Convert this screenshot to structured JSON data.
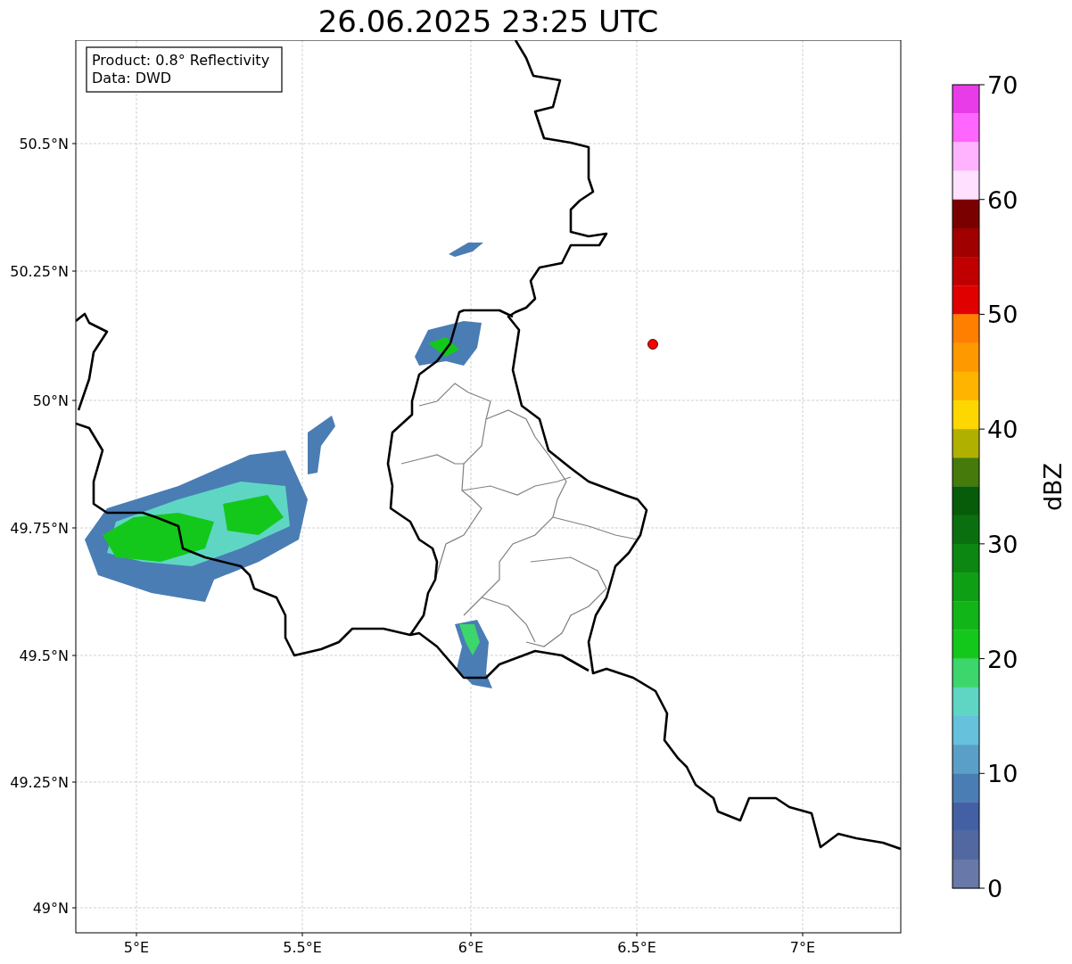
{
  "title": "26.06.2025 23:25 UTC",
  "legend": [
    "Product: 0.8° Reflectivity",
    "Data: DWD"
  ],
  "y_ticks": [
    "50.5°N",
    "50.25°N",
    "50°N",
    "49.75°N",
    "49.5°N",
    "49.25°N",
    "49°N"
  ],
  "x_ticks": [
    "5°E",
    "5.5°E",
    "6°E",
    "6.5°E",
    "7°E"
  ],
  "colorbar": {
    "label": "dBZ",
    "ticks": [
      "70",
      "60",
      "50",
      "40",
      "30",
      "20",
      "10",
      "0"
    ],
    "bins": [
      {
        "color": "#e93ce9"
      },
      {
        "color": "#ff66ff"
      },
      {
        "color": "#ffb3ff"
      },
      {
        "color": "#ffe0ff"
      },
      {
        "color": "#7a0000"
      },
      {
        "color": "#a00000"
      },
      {
        "color": "#c00000"
      },
      {
        "color": "#e00000"
      },
      {
        "color": "#ff7f00"
      },
      {
        "color": "#ff9900"
      },
      {
        "color": "#ffb400"
      },
      {
        "color": "#ffd700"
      },
      {
        "color": "#b0b000"
      },
      {
        "color": "#467a0a"
      },
      {
        "color": "#075c0a"
      },
      {
        "color": "#0a700f"
      },
      {
        "color": "#0c8712"
      },
      {
        "color": "#0f9f14"
      },
      {
        "color": "#11b518"
      },
      {
        "color": "#13c81b"
      },
      {
        "color": "#3cd66c"
      },
      {
        "color": "#5fd6c4"
      },
      {
        "color": "#65c1dc"
      },
      {
        "color": "#5a9fc8"
      },
      {
        "color": "#4a7db4"
      },
      {
        "color": "#4460a4"
      },
      {
        "color": "#5268a0"
      },
      {
        "color": "#6878a8"
      }
    ]
  }
}
